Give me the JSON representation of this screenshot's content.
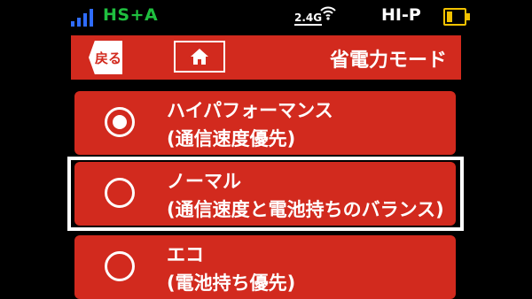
{
  "status_bar": {
    "network_type": "HS+A",
    "wifi_band": "2.4G",
    "mode": "HI-P",
    "battery_level_fraction": 0.35,
    "icons": [
      "signal-bars-icon",
      "wifi-icon",
      "battery-icon"
    ]
  },
  "header": {
    "back_label": "戻る",
    "home_icon": "home-icon",
    "title": "省電力モード",
    "bg_color": "#d22a1e"
  },
  "options": [
    {
      "title": "ハイパフォーマンス",
      "subtitle": "(通信速度優先)",
      "selected": true,
      "focused": false
    },
    {
      "title": "ノーマル",
      "subtitle": "(通信速度と電池持ちのバランス)",
      "selected": false,
      "focused": true
    },
    {
      "title": "エコ",
      "subtitle": "(電池持ち優先)",
      "selected": false,
      "focused": false
    }
  ]
}
